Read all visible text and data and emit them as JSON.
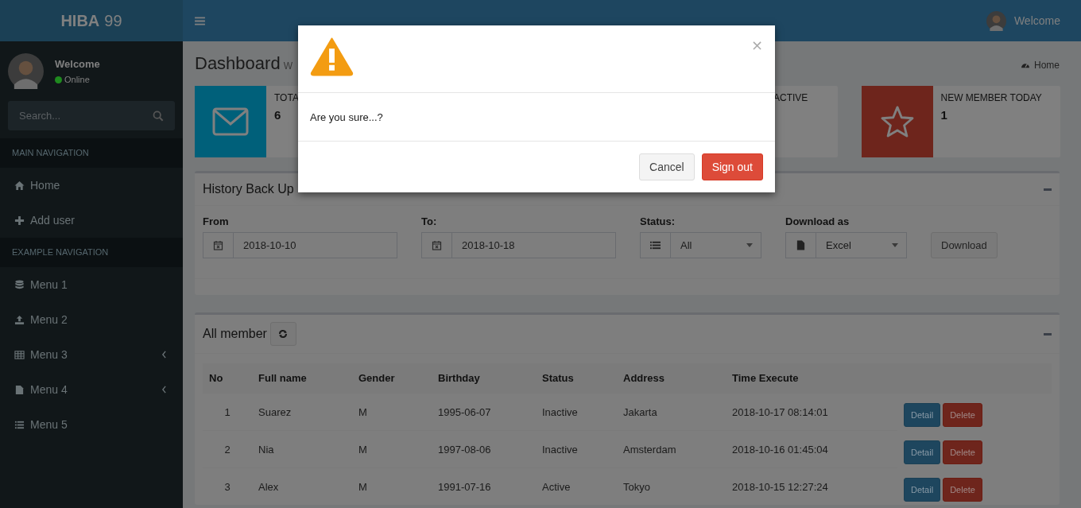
{
  "logo": {
    "bold": "HIBA",
    "light": "99"
  },
  "user_panel": {
    "name": "Welcome",
    "status": "Online"
  },
  "search": {
    "placeholder": "Search..."
  },
  "nav": [
    {
      "kind": "header",
      "label": "MAIN NAVIGATION"
    },
    {
      "kind": "home",
      "label": "Home",
      "expandable": false
    },
    {
      "kind": "plus",
      "label": "Add user",
      "expandable": false
    },
    {
      "kind": "header",
      "label": "EXAMPLE NAVIGATION"
    },
    {
      "kind": "database",
      "label": "Menu 1",
      "expandable": false
    },
    {
      "kind": "upload",
      "label": "Menu 2",
      "expandable": false
    },
    {
      "kind": "table",
      "label": "Menu 3",
      "expandable": true
    },
    {
      "kind": "file",
      "label": "Menu 4",
      "expandable": true
    },
    {
      "kind": "list",
      "label": "Menu 5",
      "expandable": false
    }
  ],
  "top_bar": {
    "user": "Welcome"
  },
  "page": {
    "title": "Dashboard",
    "subtitle": "W",
    "breadcrumb": "Home"
  },
  "info_boxes": [
    {
      "kind": "envelope",
      "color": "#00607a",
      "label": "TOTA",
      "value": "6"
    },
    {
      "label": "ACTIVE"
    },
    {
      "kind": "star",
      "color": "#6e251c",
      "label": "NEW MEMBER TODAY",
      "value": "1"
    }
  ],
  "history": {
    "title": "History Back Up",
    "fields": [
      {
        "kind": "date",
        "label": "From",
        "value": "2018-10-10"
      },
      {
        "kind": "date",
        "label": "To:",
        "value": "2018-10-18"
      },
      {
        "kind": "select",
        "label": "Status:",
        "value": "All"
      },
      {
        "kind": "select",
        "label": "Download as",
        "value": "Excel"
      }
    ],
    "button": "Download"
  },
  "members": {
    "title": "All member",
    "columns": [
      "No",
      "Full name",
      "Gender",
      "Birthday",
      "Status",
      "Address",
      "Time Execute"
    ],
    "rows": [
      {
        "cells": [
          "1",
          "Suarez",
          "M",
          "1995-06-07",
          "Inactive",
          "Jakarta",
          "2018-10-17 08:14:01"
        ],
        "actions": [
          {
            "kind": "primary",
            "label": "Detail"
          },
          {
            "kind": "danger",
            "label": "Delete"
          }
        ]
      },
      {
        "cells": [
          "2",
          "Nia",
          "M",
          "1997-08-06",
          "Inactive",
          "Amsterdam",
          "2018-10-16 01:45:04"
        ],
        "actions": [
          {
            "kind": "primary",
            "label": "Detail"
          },
          {
            "kind": "danger",
            "label": "Delete"
          }
        ]
      },
      {
        "cells": [
          "3",
          "Alex",
          "M",
          "1991-07-16",
          "Active",
          "Tokyo",
          "2018-10-15 12:27:24"
        ],
        "actions": [
          {
            "kind": "primary",
            "label": "Detail"
          },
          {
            "kind": "danger",
            "label": "Delete"
          }
        ]
      }
    ]
  },
  "modal": {
    "close": "×",
    "message": "Are you sure...?",
    "buttons": [
      {
        "kind": "default",
        "label": "Cancel"
      },
      {
        "kind": "danger",
        "label": "Sign out"
      }
    ]
  }
}
